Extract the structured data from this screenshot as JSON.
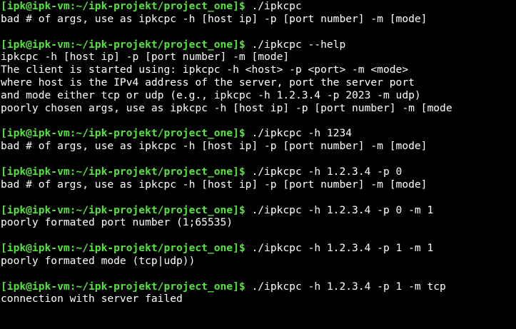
{
  "prompt_text": "[ipk@ipk-vm:~/ipk-projekt/project_one]$",
  "colors": {
    "background": "#000000",
    "prompt": "#55e43c",
    "text": "#ffffff"
  },
  "sessions": [
    {
      "command": " ./ipkcpc",
      "output": [
        "bad # of args, use as ipkcpc -h [host ip] -p [port number] -m [mode]"
      ]
    },
    {
      "command": " ./ipkcpc --help",
      "output": [
        "ipkcpc -h [host ip] -p [port number] -m [mode]",
        "The client is started using: ipkcpc -h <host> -p <port> -m <mode>",
        "where host is the IPv4 address of the server, port the server port",
        "and mode either tcp or udp (e.g., ipkcpc -h 1.2.3.4 -p 2023 -m udp)",
        "poorly chosen args, use as ipkcpc -h [host ip] -p [port number] -m [mode"
      ]
    },
    {
      "command": " ./ipkcpc -h 1234",
      "output": [
        "bad # of args, use as ipkcpc -h [host ip] -p [port number] -m [mode]"
      ]
    },
    {
      "command": " ./ipkcpc -h 1.2.3.4 -p 0",
      "output": [
        "bad # of args, use as ipkcpc -h [host ip] -p [port number] -m [mode]"
      ]
    },
    {
      "command": " ./ipkcpc -h 1.2.3.4 -p 0 -m 1",
      "output": [
        "poorly formated port number (1;65535)"
      ]
    },
    {
      "command": " ./ipkcpc -h 1.2.3.4 -p 1 -m 1",
      "output": [
        "poorly formated mode (tcp|udp))"
      ]
    },
    {
      "command": " ./ipkcpc -h 1.2.3.4 -p 1 -m tcp",
      "output": [
        "connection with server failed"
      ]
    }
  ]
}
